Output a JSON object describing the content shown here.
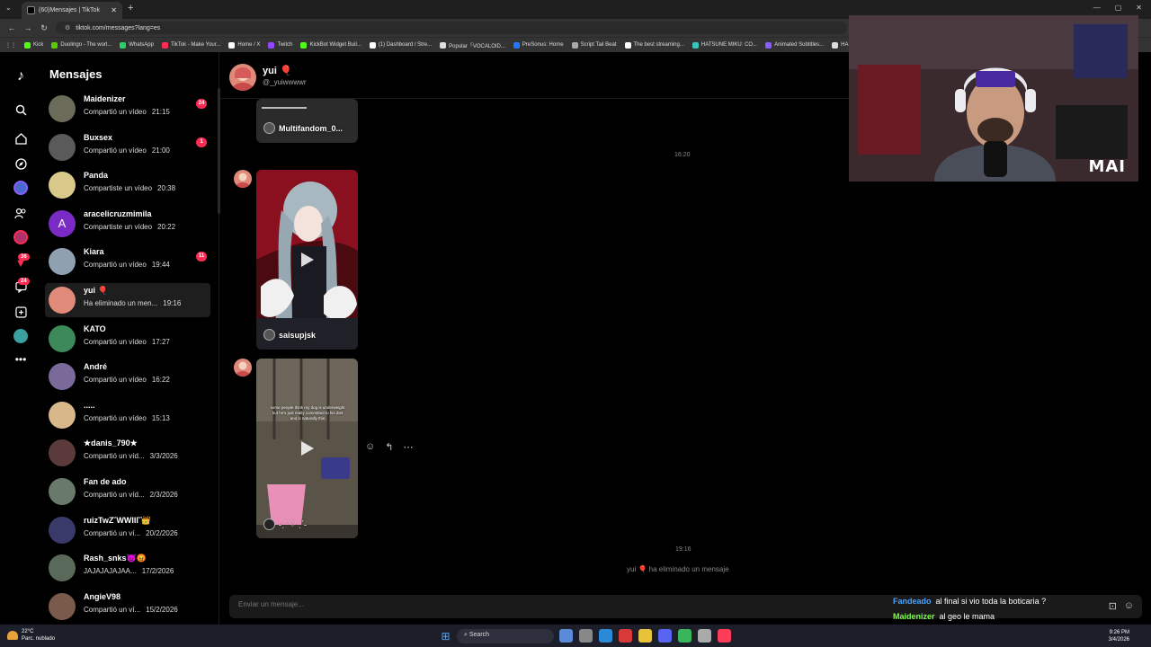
{
  "browser": {
    "tab_title": "(60)Mensajes | TikTok",
    "url": "tiktok.com/messages?lang=es",
    "bookmarks": [
      {
        "label": "Kick",
        "color": "#53fc18"
      },
      {
        "label": "Duolingo - The worl...",
        "color": "#58cc02"
      },
      {
        "label": "WhatsApp",
        "color": "#25d366"
      },
      {
        "label": "TikTok - Make Your...",
        "color": "#fe2c55"
      },
      {
        "label": "Home / X",
        "color": "#ffffff"
      },
      {
        "label": "Twitch",
        "color": "#9146ff"
      },
      {
        "label": "KickBot Widget Buil...",
        "color": "#53fc18"
      },
      {
        "label": "(1) Dashboard / Stre...",
        "color": "#ffffff"
      },
      {
        "label": "Popular「VOCALOID...",
        "color": "#dddddd"
      },
      {
        "label": "PreSonus: Home",
        "color": "#2277ff"
      },
      {
        "label": "Script Tail Beat",
        "color": "#aaaaaa"
      },
      {
        "label": "The best streaming...",
        "color": "#ffffff"
      },
      {
        "label": "HATSUNE MIKU: CO...",
        "color": "#39c5bb"
      },
      {
        "label": "Animated Subtitles...",
        "color": "#8a5cff"
      },
      {
        "label": "HA",
        "color": "#dddddd"
      }
    ]
  },
  "tiktok": {
    "sidebar_title": "Mensajes",
    "rail_badges": {
      "activity": "36",
      "inbox": "24"
    },
    "conversations": [
      {
        "name": "Maidenizer",
        "preview": "Compartió un vídeo",
        "time": "21:15",
        "badge": "24",
        "color": "#6b6b5a"
      },
      {
        "name": "Buxsex",
        "preview": "Compartió un vídeo",
        "time": "21:00",
        "badge": "1",
        "color": "#5a5a5a"
      },
      {
        "name": "Panda",
        "preview": "Compartiste un vídeo",
        "time": "20:38",
        "badge": "",
        "color": "#d8c98a"
      },
      {
        "name": "aracelicruzmimila",
        "preview": "Compartiste un vídeo",
        "time": "20:22",
        "badge": "",
        "color": "#7a2bc4",
        "initial": "A"
      },
      {
        "name": "Kiara",
        "preview": "Compartió un vídeo",
        "time": "19:44",
        "badge": "11",
        "color": "#8fa0b0"
      },
      {
        "name": "yui 🎈",
        "preview": "Ha eliminado un men...",
        "time": "19:16",
        "badge": "",
        "color": "#e08a7a"
      },
      {
        "name": "KATO",
        "preview": "Compartió un vídeo",
        "time": "17:27",
        "badge": "",
        "color": "#3c8a5a"
      },
      {
        "name": "André",
        "preview": "Compartió un vídeo",
        "time": "16:22",
        "badge": "",
        "color": "#7a6a9a"
      },
      {
        "name": ".....",
        "preview": "Compartió un vídeo",
        "time": "15:13",
        "badge": "",
        "color": "#d8b88a"
      },
      {
        "name": "★danis_790★",
        "preview": "Compartió un víd...",
        "time": "3/3/2026",
        "badge": "",
        "color": "#5a3a3a"
      },
      {
        "name": "Fan de ado",
        "preview": "Compartió un víd...",
        "time": "2/3/2026",
        "badge": "",
        "color": "#6a7a6a"
      },
      {
        "name": "ruizTwZ˘WWIII˘👑",
        "preview": "Compartió un ví...",
        "time": "20/2/2026",
        "badge": "",
        "color": "#3a3a6a"
      },
      {
        "name": "Rash_snks😈😡",
        "preview": "JAJAJAJAJAA...",
        "time": "17/2/2026",
        "badge": "",
        "color": "#5a6a5a"
      },
      {
        "name": "AngieV98",
        "preview": "Compartió un ví...",
        "time": "15/2/2026",
        "badge": "",
        "color": "#7a5a4a"
      }
    ],
    "chat": {
      "name": "yui 🎈",
      "username": "@_yuiwwwwr",
      "card1_label": "Multifandom_0...",
      "timestamp1": "16:20",
      "card2_label": "saisupjsk",
      "card3_caption": "some people think my dog is underweight but he's just really committed to his diet and is naturally thin",
      "card3_label": "˗ˏˋ ♡ ˎˊ˗",
      "timestamp2": "19:16",
      "deleted_notice": "yui 🎈 ha eliminado un mensaje",
      "composer_placeholder": "Enviar un mensaje..."
    }
  },
  "stream_overlay": {
    "chat": [
      {
        "user": "Fandeado",
        "text": "al final si vio toda la boticaria ?"
      },
      {
        "user": "Maidenizer",
        "text": "al geo le mama"
      }
    ],
    "cam_logo": "MAI"
  },
  "taskbar": {
    "weather_temp": "22°C",
    "weather_desc": "Parc. nublado",
    "search_label": "Search",
    "time": "9:26 PM",
    "date": "3/4/2026"
  }
}
